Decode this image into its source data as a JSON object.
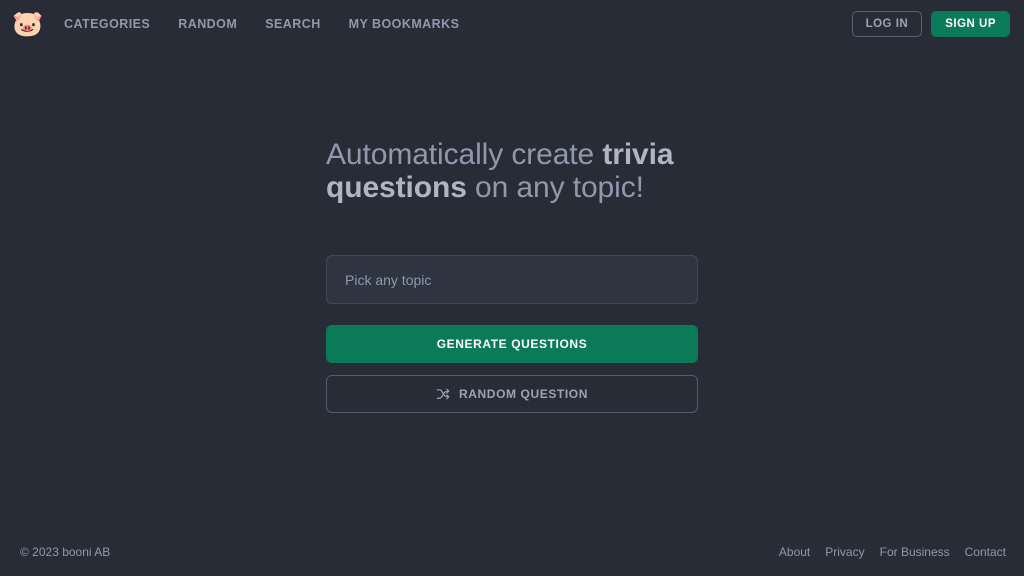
{
  "theme": {
    "background": "#282c37",
    "accent_green": "#0a7a58",
    "muted_text": "#8e99ac",
    "bright_text": "#aeb6c4",
    "border": "#565d6e"
  },
  "header": {
    "logo_icon": "pig-face-icon",
    "logo_glyph": "🐷",
    "nav": [
      {
        "label": "CATEGORIES",
        "name": "nav-link-categories"
      },
      {
        "label": "RANDOM",
        "name": "nav-link-random"
      },
      {
        "label": "SEARCH",
        "name": "nav-link-search"
      },
      {
        "label": "MY BOOKMARKS",
        "name": "nav-link-my-bookmarks"
      }
    ],
    "login_label": "LOG IN",
    "signup_label": "SIGN UP"
  },
  "hero": {
    "headline_part1": "Automatically create ",
    "headline_bold": "trivia questions",
    "headline_part2": " on any topic!",
    "topic_input": {
      "placeholder": "Pick any topic",
      "value": ""
    },
    "generate_label": "GENERATE QUESTIONS",
    "random_label": "RANDOM QUESTION",
    "random_icon": "shuffle-icon"
  },
  "footer": {
    "copyright": "© 2023 booni AB",
    "links": [
      {
        "label": "About",
        "name": "footer-link-about"
      },
      {
        "label": "Privacy",
        "name": "footer-link-privacy"
      },
      {
        "label": "For Business",
        "name": "footer-link-for-business"
      },
      {
        "label": "Contact",
        "name": "footer-link-contact"
      }
    ]
  }
}
